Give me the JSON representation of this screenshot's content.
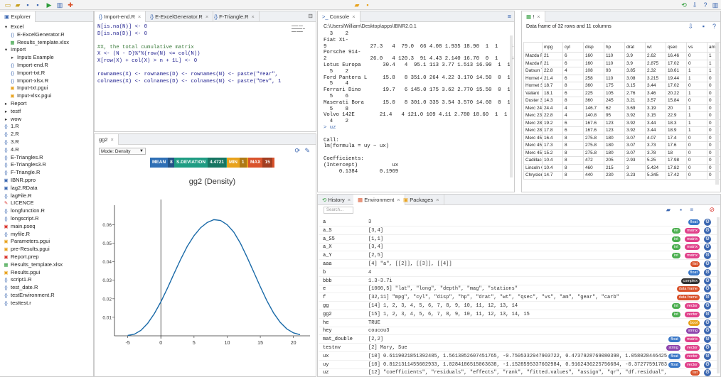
{
  "explorer": {
    "title": "Explorer",
    "items": [
      {
        "label": "Excel",
        "icon": "caret-down-icon",
        "indent": 0
      },
      {
        "label": "E-ExcelGenerator.R",
        "icon": "r-file-icon",
        "indent": 1
      },
      {
        "label": "Results_template.xlsx",
        "icon": "excel-file-icon",
        "indent": 1
      },
      {
        "label": "Import",
        "icon": "caret-down-icon",
        "indent": 0
      },
      {
        "label": "Inputs Example",
        "icon": "caret-right-icon",
        "indent": 1
      },
      {
        "label": "Import-end.R",
        "icon": "r-file-icon",
        "indent": 1
      },
      {
        "label": "Import-txt.R",
        "icon": "r-file-icon",
        "indent": 1
      },
      {
        "label": "Import-xlsx.R",
        "icon": "r-file-icon",
        "indent": 1
      },
      {
        "label": "Input-txt.pgui",
        "icon": "pgui-file-icon",
        "indent": 1
      },
      {
        "label": "Input-xlsx.pgui",
        "icon": "pgui-file-icon",
        "indent": 1
      },
      {
        "label": "Report",
        "icon": "caret-right-icon",
        "indent": 0
      },
      {
        "label": "testf",
        "icon": "caret-right-icon",
        "indent": 0
      },
      {
        "label": "wow",
        "icon": "caret-right-icon",
        "indent": 0
      },
      {
        "label": "1.R",
        "icon": "r-file-icon",
        "indent": 0
      },
      {
        "label": "2.R",
        "icon": "r-file-icon",
        "indent": 0
      },
      {
        "label": "3.R",
        "icon": "r-file-icon",
        "indent": 0
      },
      {
        "label": "4.R",
        "icon": "r-file-icon",
        "indent": 0
      },
      {
        "label": "E-Triangles.R",
        "icon": "r-file-icon",
        "indent": 0
      },
      {
        "label": "E-Triangles3.R",
        "icon": "r-file-icon",
        "indent": 0
      },
      {
        "label": "F-Triangle.R",
        "icon": "r-file-icon",
        "indent": 0
      },
      {
        "label": "IBNR.ppro",
        "icon": "ppro-file-icon",
        "indent": 0
      },
      {
        "label": "lag2.RData",
        "icon": "rdata-file-icon",
        "indent": 0
      },
      {
        "label": "lagFile.R",
        "icon": "r-file-icon",
        "indent": 0
      },
      {
        "label": "LICENCE",
        "icon": "licence-file-icon",
        "indent": 0
      },
      {
        "label": "longfunction.R",
        "icon": "r-file-icon",
        "indent": 0
      },
      {
        "label": "longscript.R",
        "icon": "r-file-icon",
        "indent": 0
      },
      {
        "label": "main.pseq",
        "icon": "pseq-file-icon",
        "indent": 0
      },
      {
        "label": "myfile.R",
        "icon": "r-file-icon",
        "indent": 0
      },
      {
        "label": "Parameters.pgui",
        "icon": "pgui-file-icon",
        "indent": 0
      },
      {
        "label": "pre-Results.pgui",
        "icon": "pgui-file-icon",
        "indent": 0
      },
      {
        "label": "Report.prep",
        "icon": "prep-file-icon",
        "indent": 0
      },
      {
        "label": "Results_template.xlsx",
        "icon": "excel-file-icon",
        "indent": 0
      },
      {
        "label": "Results.pgui",
        "icon": "pgui-file-icon",
        "indent": 0
      },
      {
        "label": "script1.R",
        "icon": "r-file-icon",
        "indent": 0
      },
      {
        "label": "test_date.R",
        "icon": "r-file-icon",
        "indent": 0
      },
      {
        "label": "testEnvironment.R",
        "icon": "r-file-icon",
        "indent": 0
      },
      {
        "label": "testtest.r",
        "icon": "r-file-icon",
        "indent": 0
      }
    ]
  },
  "editor": {
    "tabs": [
      "Import-end.R",
      "E-ExcelGenerator.R",
      "F-Triangle.R"
    ],
    "lines": [
      "N[is.na(N)] <- 0",
      "D[is.na(D)] <- 0",
      "",
      "#X, the total cumulative matrix",
      "X <- (N - D)%*%(row(N) <= col(N))",
      "X[row(X) + col(X) > n + 1L] <- 0",
      "",
      "rownames(X) <- rownames(D) <- rownames(N) <- paste(\"Year\",",
      "colnames(X) <- colnames(D) <- colnames(N) <- paste(\"Dev\", 1"
    ]
  },
  "plot": {
    "tab": "gg2",
    "mode_label": "Mode: Density",
    "stats": [
      {
        "label": "MEAN",
        "value": "8",
        "color": "#2f6fb5"
      },
      {
        "label": "S.DEVIATION",
        "value": "4.4721",
        "color": "#1f9c83"
      },
      {
        "label": "MIN",
        "value": "1",
        "color": "#e8a21c"
      },
      {
        "label": "MAX",
        "value": "15",
        "color": "#d9532c"
      }
    ]
  },
  "chart_data": {
    "type": "line",
    "title": "gg2 (Density)",
    "xlabel": "",
    "ylabel": "",
    "xlim": [
      -7,
      22.5
    ],
    "ylim": [
      0,
      0.069
    ],
    "xticks": [
      -5,
      0,
      5,
      10,
      15,
      20
    ],
    "yticks": [
      0.01,
      0.02,
      0.03,
      0.04,
      0.05,
      0.06
    ],
    "ytick_labels": [
      "0.01",
      "0.02",
      "0.03",
      "0.04",
      "0.05",
      "0.06"
    ],
    "vline_x": 0,
    "series": [
      {
        "color": "#1a6aa8",
        "x": [
          -5,
          -4,
          -3,
          -2,
          -1,
          0,
          1,
          2,
          3,
          4,
          5,
          6,
          7,
          8,
          9,
          10,
          11,
          12,
          13,
          14,
          15,
          16,
          17,
          18,
          19,
          20,
          21
        ],
        "y": [
          0.0002,
          0.0009,
          0.003,
          0.0067,
          0.0119,
          0.0184,
          0.0258,
          0.0337,
          0.0414,
          0.0484,
          0.0541,
          0.0584,
          0.0612,
          0.0627,
          0.0623,
          0.06,
          0.056,
          0.05,
          0.0425,
          0.0345,
          0.0265,
          0.0189,
          0.0124,
          0.0073,
          0.0037,
          0.0016,
          0.0006
        ]
      }
    ]
  },
  "console": {
    "tab": "Console",
    "path": "C:\\Users\\William\\Desktop\\apps\\IBNR2.0.1",
    "lines": [
      "  3    2",
      "Fiat X1-",
      "9              27.3   4  79.0  66 4.08 1.935 18.90  1  1    4    1",
      "Porsche 914-",
      "2              26.0   4 120.3  91 4.43 2.140 16.70  0  1    5    2",
      "Lotus Europa       30.4   4  95.1 113 3.77 1.513 16.90  1  1",
      "  5    2",
      "Ford Pantera L     15.8   8 351.0 264 4.22 3.170 14.50  0  1",
      "  5    4",
      "Ferrari Dino       19.7   6 145.0 175 3.62 2.770 15.50  0  1",
      "  5    6",
      "Maserati Bora      15.0   8 301.0 335 3.54 3.570 14.60  0  1",
      "  5    8",
      "Volvo 142E        21.4   4 121.0 109 4.11 2.780 18.60  1  1",
      "  4    2",
      "> uz",
      "",
      "Call:",
      "lm(formula = uy ~ ux)",
      "",
      "Coefficients:",
      "(Intercept)           ux",
      "     0.1384       0.1969",
      "",
      "",
      "",
      "",
      "",
      "> |"
    ]
  },
  "dataframe": {
    "tab": "!",
    "caption": "Data frame of 32 rows and 11 columns",
    "columns": [
      "",
      "mpg",
      "cyl",
      "disp",
      "hp",
      "drat",
      "wt",
      "qsec",
      "vs",
      "am",
      "g"
    ],
    "rows": [
      [
        "Mazda R",
        "21",
        "6",
        "160",
        "110",
        "3.9",
        "2.62",
        "16.46",
        "0",
        "1",
        "4"
      ],
      [
        "Mazda R",
        "21",
        "6",
        "160",
        "110",
        "3.9",
        "2.875",
        "17.02",
        "0",
        "1",
        "4"
      ],
      [
        "Datsun 7",
        "22.8",
        "4",
        "108",
        "93",
        "3.85",
        "2.32",
        "18.61",
        "1",
        "1",
        "4"
      ],
      [
        "Hornet 4",
        "21.4",
        "6",
        "258",
        "110",
        "3.08",
        "3.215",
        "19.44",
        "1",
        "0",
        "3"
      ],
      [
        "Hornet S",
        "18.7",
        "8",
        "360",
        "175",
        "3.15",
        "3.44",
        "17.02",
        "0",
        "0",
        "3"
      ],
      [
        "Valiant",
        "18.1",
        "6",
        "225",
        "105",
        "2.76",
        "3.46",
        "20.22",
        "1",
        "0",
        "3"
      ],
      [
        "Duster 3",
        "14.3",
        "8",
        "360",
        "245",
        "3.21",
        "3.57",
        "15.84",
        "0",
        "0",
        "3"
      ],
      [
        "Merc 24",
        "24.4",
        "4",
        "146.7",
        "62",
        "3.69",
        "3.19",
        "20",
        "1",
        "0",
        "4"
      ],
      [
        "Merc 23",
        "22.8",
        "4",
        "140.8",
        "95",
        "3.92",
        "3.15",
        "22.9",
        "1",
        "0",
        "4"
      ],
      [
        "Merc 28",
        "19.2",
        "6",
        "167.6",
        "123",
        "3.92",
        "3.44",
        "18.3",
        "1",
        "0",
        "4"
      ],
      [
        "Merc 28",
        "17.8",
        "6",
        "167.6",
        "123",
        "3.92",
        "3.44",
        "18.9",
        "1",
        "0",
        "4"
      ],
      [
        "Merc 45",
        "16.4",
        "8",
        "275.8",
        "180",
        "3.07",
        "4.07",
        "17.4",
        "0",
        "0",
        "3"
      ],
      [
        "Merc 45",
        "17.3",
        "8",
        "275.8",
        "180",
        "3.07",
        "3.73",
        "17.6",
        "0",
        "0",
        "3"
      ],
      [
        "Merc 45",
        "15.2",
        "8",
        "275.8",
        "180",
        "3.07",
        "3.78",
        "18",
        "0",
        "0",
        "3"
      ],
      [
        "Cadillac",
        "10.4",
        "8",
        "472",
        "205",
        "2.93",
        "5.25",
        "17.98",
        "0",
        "0",
        "3"
      ],
      [
        "Lincoln C",
        "10.4",
        "8",
        "460",
        "215",
        "3",
        "5.424",
        "17.82",
        "0",
        "0",
        "3"
      ],
      [
        "Chrysler",
        "14.7",
        "8",
        "440",
        "230",
        "3.23",
        "5.345",
        "17.42",
        "0",
        "0",
        "3"
      ]
    ]
  },
  "environment": {
    "tabs": [
      "History",
      "Environment",
      "Packages"
    ],
    "search_placeholder": "Search...",
    "rows": [
      {
        "name": "a",
        "value": "3",
        "tags": [
          {
            "t": "float",
            "c": "#3a78c8"
          }
        ]
      },
      {
        "name": "a_S",
        "value": "[3,4]",
        "tags": [
          {
            "t": "int",
            "c": "#4caf50"
          },
          {
            "t": "matrix",
            "c": "#e0408a"
          }
        ]
      },
      {
        "name": "a_S5",
        "value": "[1,1]",
        "tags": [
          {
            "t": "int",
            "c": "#4caf50"
          },
          {
            "t": "matrix",
            "c": "#e0408a"
          }
        ]
      },
      {
        "name": "a_X",
        "value": "[3,4]",
        "tags": [
          {
            "t": "int",
            "c": "#4caf50"
          },
          {
            "t": "matrix",
            "c": "#e0408a"
          }
        ]
      },
      {
        "name": "a_Y",
        "value": "[2,5]",
        "tags": [
          {
            "t": "int",
            "c": "#4caf50"
          },
          {
            "t": "matrix",
            "c": "#e0408a"
          }
        ]
      },
      {
        "name": "aaa",
        "value": "[4] \"a\", [[2]], [[3]], [[4]]",
        "tags": [
          {
            "t": "list",
            "c": "#d9532c"
          }
        ]
      },
      {
        "name": "b",
        "value": "4",
        "tags": [
          {
            "t": "float",
            "c": "#3a78c8"
          }
        ]
      },
      {
        "name": "bbb",
        "value": "1.3-3.7i",
        "tags": [
          {
            "t": "complex",
            "c": "#333333"
          }
        ]
      },
      {
        "name": "e",
        "value": "[1000,5] \"lat\", \"long\", \"depth\", \"mag\", \"stations\"",
        "tags": [
          {
            "t": "data frame",
            "c": "#d9532c"
          }
        ]
      },
      {
        "name": "f",
        "value": "[32,11] \"mpg\", \"cyl\", \"disp\", \"hp\", \"drat\", \"wt\", \"qsec\", \"vs\", \"am\", \"gear\", \"carb\"",
        "tags": [
          {
            "t": "data frame",
            "c": "#d9532c"
          }
        ]
      },
      {
        "name": "gg",
        "value": "[14] 1, 2, 3, 4, 5, 6, 7, 8, 9, 10, 11, 12, 13, 14",
        "tags": [
          {
            "t": "int",
            "c": "#4caf50"
          },
          {
            "t": "vector",
            "c": "#e0408a"
          }
        ]
      },
      {
        "name": "gg2",
        "value": "[15] 1, 2, 3, 4, 5, 6, 7, 8, 9, 10, 11, 12, 13, 14, 15",
        "tags": [
          {
            "t": "int",
            "c": "#4caf50"
          },
          {
            "t": "vector",
            "c": "#e0408a"
          }
        ]
      },
      {
        "name": "he",
        "value": "TRUE",
        "tags": [
          {
            "t": "bool",
            "c": "#e8a21c"
          }
        ]
      },
      {
        "name": "hey",
        "value": "coucou3",
        "tags": [
          {
            "t": "string",
            "c": "#8e44ad"
          }
        ]
      },
      {
        "name": "mat_double",
        "value": "[2,2]",
        "tags": [
          {
            "t": "float",
            "c": "#3a78c8"
          },
          {
            "t": "matrix",
            "c": "#e0408a"
          }
        ]
      },
      {
        "name": "testnv",
        "value": "[2] Mary, Sue",
        "tags": [
          {
            "t": "string",
            "c": "#8e44ad"
          },
          {
            "t": "vector",
            "c": "#e0408a"
          }
        ]
      },
      {
        "name": "ux",
        "value": "[10] 0.6119021851392485, 1.5613052607451765, -0.7505332947903722, 0.4737928769080398, 1.0580284464257312, -0.",
        "tags": [
          {
            "t": "float",
            "c": "#3a78c8"
          },
          {
            "t": "vector",
            "c": "#e0408a"
          }
        ]
      },
      {
        "name": "uy",
        "value": "[10] 0.8121311455602933, 1.0284186515063638, -1.1528595337602984, 0.9162436225756684, -0.3727759178376416, 0.",
        "tags": [
          {
            "t": "float",
            "c": "#3a78c8"
          },
          {
            "t": "vector",
            "c": "#e0408a"
          }
        ]
      },
      {
        "name": "uz",
        "value": "[12] \"coefficients\", \"residuals\", \"effects\", \"rank\", \"fitted.values\", \"assign\", \"qr\", \"df.residual\", \"xlevels",
        "tags": [
          {
            "t": "list",
            "c": "#d9532c"
          }
        ]
      }
    ]
  }
}
